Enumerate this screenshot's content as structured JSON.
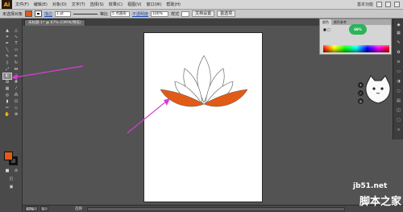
{
  "app": {
    "logo": "Ai"
  },
  "menu": {
    "items": [
      "文件(F)",
      "编辑(E)",
      "对象(O)",
      "文字(T)",
      "选择(S)",
      "效果(C)",
      "视图(V)",
      "窗口(W)",
      "帮助(H)"
    ],
    "workspace": "基本功能"
  },
  "control": {
    "mode_label": "未选择对象",
    "stroke_label": "描边",
    "stroke_weight": "1 pt",
    "profile": "等比",
    "brush": "5 点圆形",
    "opacity_link": "不透明度",
    "opacity_value": "100%",
    "style_label": "样式",
    "doc_setup": "文档设置",
    "prefs": "首选项"
  },
  "document": {
    "tab_title": "未标题-1* @ 67% (CMYK/预览)"
  },
  "status": {
    "zoom": "67%",
    "page": "1",
    "tool_name": "选择"
  },
  "color_panel": {
    "tabs": [
      "颜色",
      "颜色参考"
    ],
    "badge": "69%"
  },
  "watermark": {
    "site": "jb51.net",
    "brand": "脚本之家"
  },
  "colors": {
    "accent": "#e25b16",
    "annotation": "#d63fd3"
  },
  "icons": {
    "tools": [
      "selection-arrow-icon",
      "direct-selection-icon",
      "magic-wand-icon",
      "lasso-icon",
      "pen-icon",
      "type-icon",
      "line-icon",
      "rectangle-icon",
      "paintbrush-icon",
      "pencil-icon",
      "eraser-icon",
      "rotate-icon",
      "scale-icon",
      "width-icon",
      "free-transform-icon",
      "shape-builder-icon",
      "perspective-icon",
      "mesh-icon",
      "gradient-icon",
      "eyedropper-icon",
      "blend-icon",
      "symbol-sprayer-icon",
      "column-graph-icon",
      "artboard-icon",
      "slice-icon",
      "hand-icon",
      "zoom-icon"
    ]
  }
}
